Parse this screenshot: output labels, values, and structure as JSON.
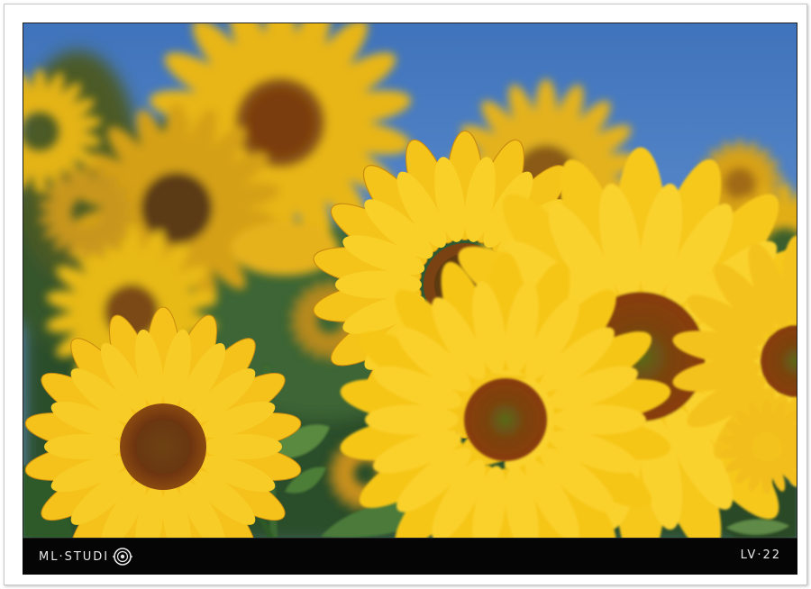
{
  "footer": {
    "brand_label": "ML·STUDI",
    "frame_label": "LV·22"
  },
  "colors": {
    "sky": "#4a7fc4",
    "petal": "#f5c514",
    "center": "#6b3a10",
    "leaf": "#2f5a2a",
    "bar": "#050505"
  },
  "icons": {
    "brand_mark": "aperture-o-icon"
  }
}
